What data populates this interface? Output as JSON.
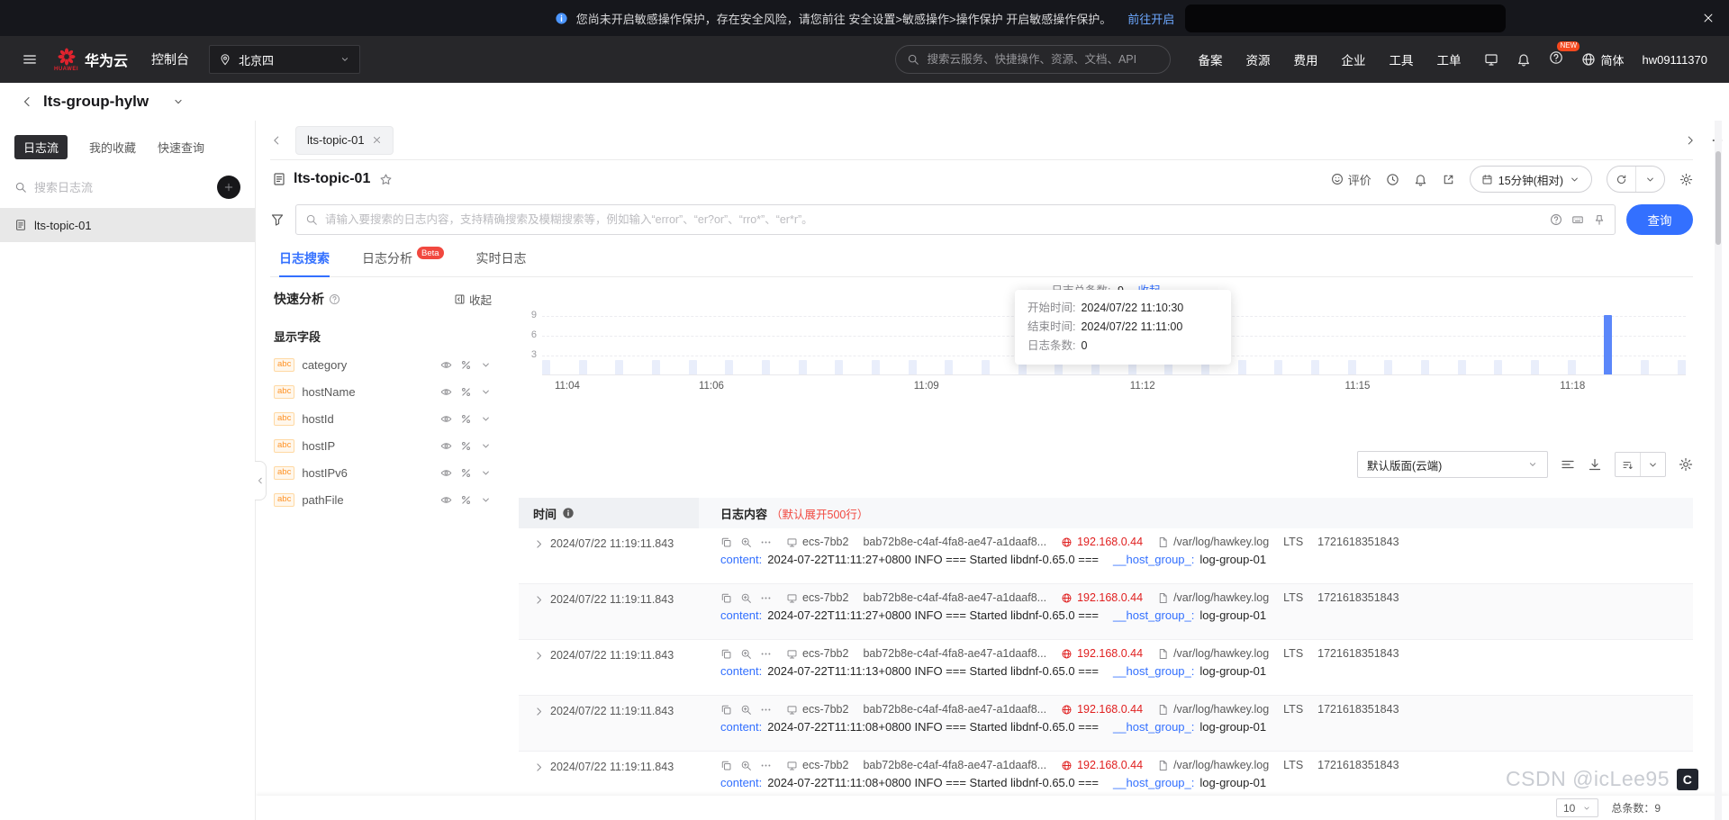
{
  "notification": {
    "message": "您尚未开启敏感操作保护，存在安全风险，请您前往 安全设置>敏感操作>操作保护 开启敏感操作保护。",
    "link": "前往开启"
  },
  "topnav": {
    "logo_text": "华为云",
    "logo_sub": "HUAWEI",
    "console": "控制台",
    "region": "北京四",
    "search_placeholder": "搜索云服务、快捷操作、资源、文档、API",
    "menu": [
      "备案",
      "资源",
      "费用",
      "企业",
      "工具",
      "工单"
    ],
    "new_badge": "NEW",
    "language": "简体",
    "username": "hw09111370"
  },
  "page_header": {
    "group_name": "lts-group-hylw"
  },
  "sidebar": {
    "tabs": [
      {
        "label": "日志流",
        "active": true
      },
      {
        "label": "我的收藏",
        "active": false
      },
      {
        "label": "快速查询",
        "active": false
      }
    ],
    "search_placeholder": "搜索日志流",
    "streams": [
      {
        "label": "lts-topic-01",
        "selected": true
      }
    ]
  },
  "workspace": {
    "tab_label": "lts-topic-01",
    "title": "lts-topic-01",
    "feedback": "评价",
    "time_range": "15分钟(相对)",
    "search_placeholder": "请输入要搜索的日志内容，支持精确搜索及模糊搜索等，例如输入“error”、“er?or”、“rro*”、“er*r”。",
    "query": "查询",
    "tabs": [
      {
        "label": "日志搜索",
        "active": true
      },
      {
        "label": "日志分析",
        "badge": "Beta",
        "active": false
      },
      {
        "label": "实时日志",
        "active": false
      }
    ]
  },
  "quick_analysis": {
    "title": "快速分析",
    "collapse": "收起",
    "fields_title": "显示字段",
    "field_type": "abc",
    "fields": [
      "category",
      "hostName",
      "hostId",
      "hostIP",
      "hostIPv6",
      "pathFile"
    ]
  },
  "chart_data": {
    "type": "bar",
    "title": "日志总条数",
    "total_label": "日志总条数:",
    "total_value": "9",
    "collapse": "收起",
    "y_max": 9,
    "y_ticks": [
      "9",
      "6",
      "3"
    ],
    "x_ticks": [
      {
        "label": "11:04",
        "pos": 2.2
      },
      {
        "label": "11:06",
        "pos": 14.8
      },
      {
        "label": "11:09",
        "pos": 33.6
      },
      {
        "label": "11:12",
        "pos": 52.5
      },
      {
        "label": "11:15",
        "pos": 71.3
      },
      {
        "label": "11:18",
        "pos": 90.1
      }
    ],
    "values": [
      0,
      0,
      0,
      0,
      0,
      0,
      0,
      0,
      0,
      0,
      0,
      0,
      0,
      0,
      0,
      0,
      0,
      0,
      0,
      0,
      0,
      0,
      0,
      0,
      0,
      0,
      0,
      0,
      0,
      9,
      0,
      0
    ],
    "bar_color": "#5b87fa",
    "empty_bar_color": "#e9eefb",
    "grid": true,
    "tooltip": [
      {
        "label": "开始时间:",
        "value": "2024/07/22 11:10:30"
      },
      {
        "label": "结束时间:",
        "value": "2024/07/22 11:11:00"
      },
      {
        "label": "日志条数:",
        "value": "0"
      }
    ]
  },
  "toolbar": {
    "layout_select": "默认版面(云端)"
  },
  "log_table": {
    "col_time": "时间",
    "col_content": "日志内容",
    "col_content_note": "（默认展开500行）",
    "rows": [
      {
        "time": "2024/07/22 11:19:11.843",
        "host": "ecs-7bb2",
        "host_id": "bab72b8e-c4af-4fa8-ae47-a1daaf8...",
        "ip": "192.168.0.44",
        "path": "/var/log/hawkey.log",
        "source": "LTS",
        "line_num": "1721618351843",
        "content_key": "content:",
        "content": "2024-07-22T11:11:27+0800 INFO === Started libdnf-0.65.0 ===",
        "group_key": "__host_group_:",
        "group_value": "log-group-01"
      },
      {
        "time": "2024/07/22 11:19:11.843",
        "host": "ecs-7bb2",
        "host_id": "bab72b8e-c4af-4fa8-ae47-a1daaf8...",
        "ip": "192.168.0.44",
        "path": "/var/log/hawkey.log",
        "source": "LTS",
        "line_num": "1721618351843",
        "content_key": "content:",
        "content": "2024-07-22T11:11:27+0800 INFO === Started libdnf-0.65.0 ===",
        "group_key": "__host_group_:",
        "group_value": "log-group-01"
      },
      {
        "time": "2024/07/22 11:19:11.843",
        "host": "ecs-7bb2",
        "host_id": "bab72b8e-c4af-4fa8-ae47-a1daaf8...",
        "ip": "192.168.0.44",
        "path": "/var/log/hawkey.log",
        "source": "LTS",
        "line_num": "1721618351843",
        "content_key": "content:",
        "content": "2024-07-22T11:11:13+0800 INFO === Started libdnf-0.65.0 ===",
        "group_key": "__host_group_:",
        "group_value": "log-group-01"
      },
      {
        "time": "2024/07/22 11:19:11.843",
        "host": "ecs-7bb2",
        "host_id": "bab72b8e-c4af-4fa8-ae47-a1daaf8...",
        "ip": "192.168.0.44",
        "path": "/var/log/hawkey.log",
        "source": "LTS",
        "line_num": "1721618351843",
        "content_key": "content:",
        "content": "2024-07-22T11:11:08+0800 INFO === Started libdnf-0.65.0 ===",
        "group_key": "__host_group_:",
        "group_value": "log-group-01"
      },
      {
        "time": "2024/07/22 11:19:11.843",
        "host": "ecs-7bb2",
        "host_id": "bab72b8e-c4af-4fa8-ae47-a1daaf8...",
        "ip": "192.168.0.44",
        "path": "/var/log/hawkey.log",
        "source": "LTS",
        "line_num": "1721618351843",
        "content_key": "content:",
        "content": "2024-07-22T11:11:08+0800 INFO === Started libdnf-0.65.0 ===",
        "group_key": "__host_group_:",
        "group_value": "log-group-01"
      }
    ]
  },
  "pagination": {
    "page_size": "10",
    "total": "总条数：9"
  },
  "watermark": {
    "text": "CSDN @icLee95",
    "logo": "C"
  }
}
